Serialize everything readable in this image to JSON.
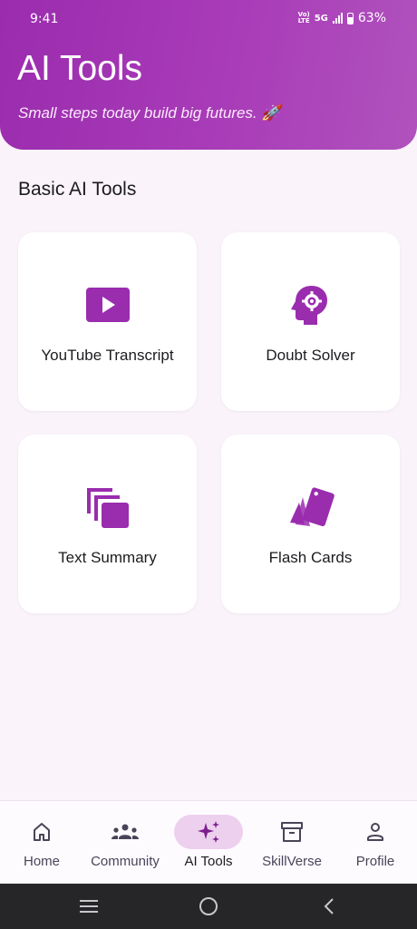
{
  "status_bar": {
    "time": "9:41",
    "volte_top": "Vo)",
    "volte_bottom": "LTE",
    "network": "5G",
    "battery": "63%"
  },
  "header": {
    "title": "AI Tools",
    "subtitle": "Small steps today build big futures. 🚀"
  },
  "section": {
    "title": "Basic AI Tools"
  },
  "tools": [
    {
      "label": "YouTube Transcript",
      "icon": "youtube-play-icon"
    },
    {
      "label": "Doubt Solver",
      "icon": "head-gear-icon"
    },
    {
      "label": "Text Summary",
      "icon": "stacked-pages-icon"
    },
    {
      "label": "Flash Cards",
      "icon": "flash-cards-icon"
    }
  ],
  "nav": {
    "items": [
      {
        "label": "Home",
        "icon": "home-icon"
      },
      {
        "label": "Community",
        "icon": "community-icon"
      },
      {
        "label": "AI Tools",
        "icon": "sparkles-icon",
        "active": true
      },
      {
        "label": "SkillVerse",
        "icon": "archive-box-icon"
      },
      {
        "label": "Profile",
        "icon": "person-icon"
      }
    ]
  },
  "colors": {
    "accent": "#9a2cae",
    "active_pill": "#ecd0ee",
    "background": "#faf3fa"
  }
}
